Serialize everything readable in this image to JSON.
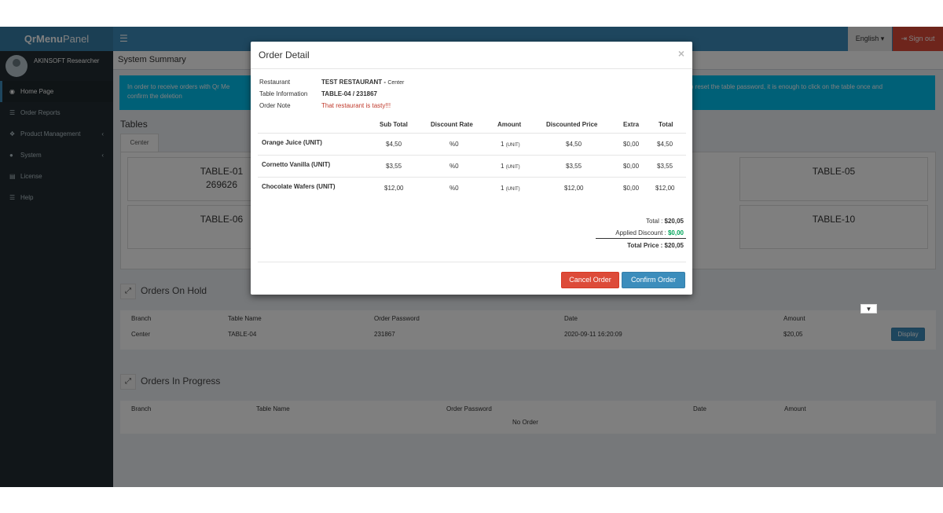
{
  "header": {
    "logo_bold": "QrMenu",
    "logo_rest": "Panel",
    "menu_icon": "bars-icon",
    "language": "English ▾",
    "sign_out": "Sign out"
  },
  "sidebar": {
    "user_name": "AKINSOFT Researcher",
    "items": [
      {
        "label": "Home Page",
        "icon": "dashboard-icon",
        "active": true
      },
      {
        "label": "Order Reports",
        "icon": "list-icon"
      },
      {
        "label": "Product Management",
        "icon": "cubes-icon",
        "arrow": "‹"
      },
      {
        "label": "System",
        "icon": "user-icon",
        "arrow": "‹"
      },
      {
        "label": "License",
        "icon": "file-icon"
      },
      {
        "label": "Help",
        "icon": "list-icon"
      }
    ]
  },
  "main": {
    "page_title": "System Summary",
    "callout_left": "In order to receive orders with Qr Me",
    "callout_left2": "confirm the deletion",
    "callout_right": "o reset the table password, it is enough to click on the table once and",
    "tables_title": "Tables",
    "tab_center": "Center",
    "tables": [
      {
        "name": "TABLE-01",
        "code": "269626"
      },
      {
        "name": "TABLE-05",
        "code": ""
      },
      {
        "name": "TABLE-06",
        "code": ""
      },
      {
        "name": "TABLE-10",
        "code": ""
      }
    ],
    "orders_on_hold": {
      "title": "Orders On Hold",
      "headers": [
        "Branch",
        "Table Name",
        "Order Password",
        "Date",
        "Amount"
      ],
      "rows": [
        {
          "branch": "Center",
          "table": "TABLE-04",
          "password": "231867",
          "date": "2020-09-11 16:20:09",
          "amount": "$20,05",
          "action": "Display"
        }
      ]
    },
    "orders_in_progress": {
      "title": "Orders In Progress",
      "headers": [
        "Branch",
        "Table Name",
        "Order Password",
        "Date",
        "Amount"
      ],
      "empty": "No Order"
    }
  },
  "modal": {
    "title": "Order Detail",
    "close": "×",
    "restaurant_label": "Restaurant",
    "restaurant_value": "TEST RESTAURANT -",
    "restaurant_branch": "Center",
    "table_label": "Table Information",
    "table_value": "TABLE-04 / 231867",
    "note_label": "Order Note",
    "note_value": "That restaurant is tasty!!!",
    "columns": [
      "Sub Total",
      "Discount Rate",
      "Amount",
      "Discounted Price",
      "Extra",
      "Total"
    ],
    "items": [
      {
        "name": "Orange Juice (UNIT)",
        "sub_total": "$4,50",
        "discount_rate": "%0",
        "amount": "1",
        "unit": "(UNIT)",
        "discounted": "$4,50",
        "extra": "$0,00",
        "total": "$4,50"
      },
      {
        "name": "Cornetto Vanilla (UNIT)",
        "sub_total": "$3,55",
        "discount_rate": "%0",
        "amount": "1",
        "unit": "(UNIT)",
        "discounted": "$3,55",
        "extra": "$0,00",
        "total": "$3,55"
      },
      {
        "name": "Chocolate Wafers (UNIT)",
        "sub_total": "$12,00",
        "discount_rate": "%0",
        "amount": "1",
        "unit": "(UNIT)",
        "discounted": "$12,00",
        "extra": "$0,00",
        "total": "$12,00"
      }
    ],
    "total_label": "Total :",
    "total_value": "$20,05",
    "discount_label": "Applied Discount :",
    "discount_value": "$0,00",
    "total_price_label": "Total Price :",
    "total_price_value": "$20,05",
    "cancel": "Cancel Order",
    "confirm": "Confirm Order"
  }
}
